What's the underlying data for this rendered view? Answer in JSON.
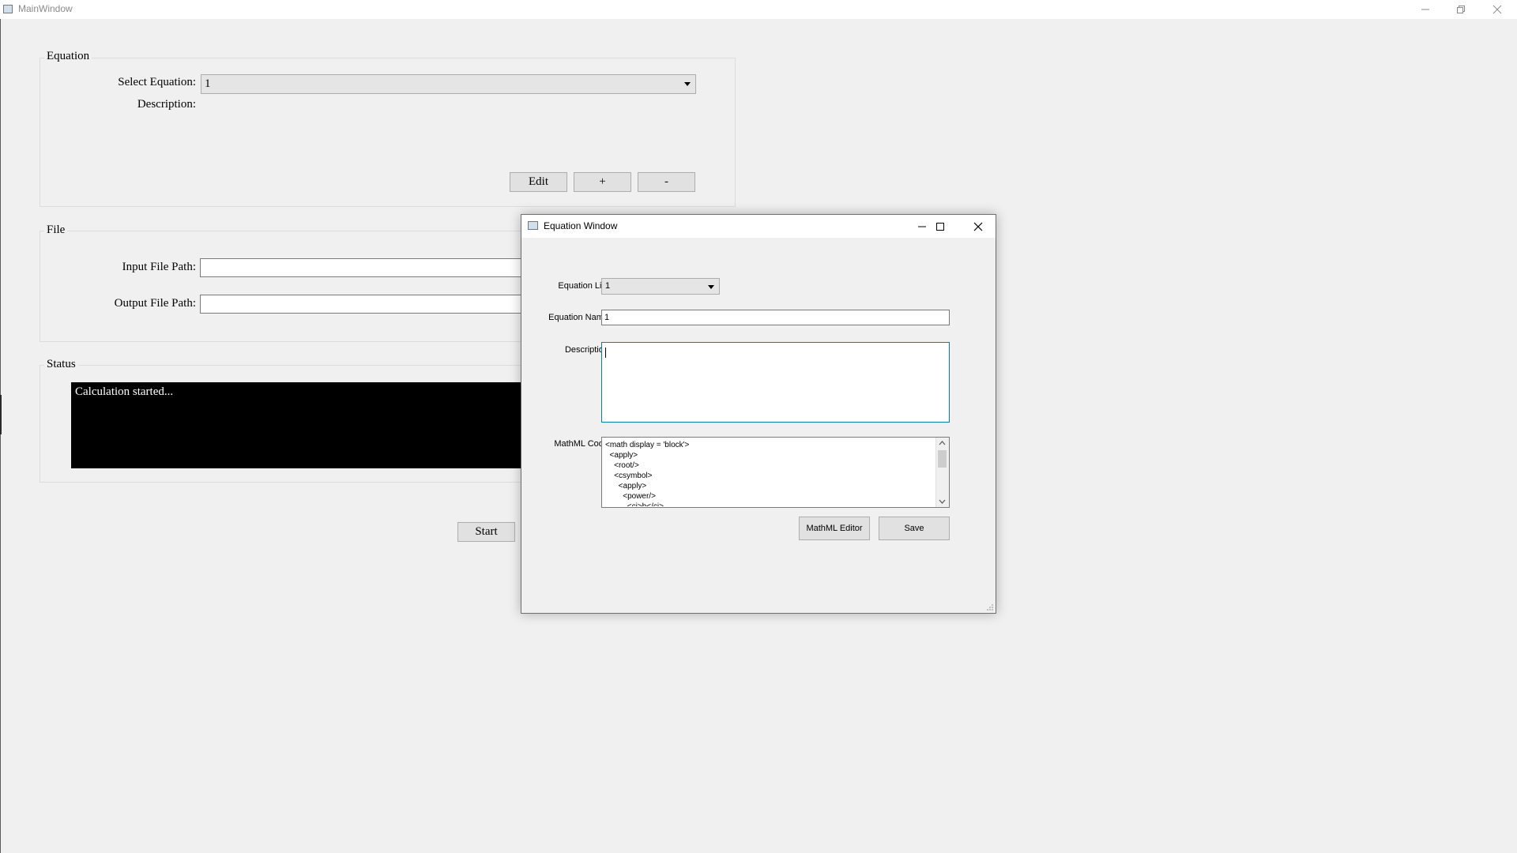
{
  "main_window": {
    "title": "MainWindow",
    "equation_group": {
      "title": "Equation",
      "select_label": "Select Equation:",
      "select_value": "1",
      "description_label": "Description:",
      "edit_label": "Edit",
      "add_label": "+",
      "remove_label": "-"
    },
    "file_group": {
      "title": "File",
      "input_label": "Input File Path:",
      "input_value": "",
      "output_label": "Output File Path:",
      "output_value": ""
    },
    "status_group": {
      "title": "Status",
      "console_text": "Calculation started..."
    },
    "start_label": "Start"
  },
  "equation_window": {
    "title": "Equation Window",
    "list_label": "Equation List",
    "list_value": "1",
    "name_label": "Equation Name",
    "name_value": "1",
    "description_label": "Description",
    "description_value": "",
    "mathml_label": "MathML Code",
    "mathml_lines": [
      "<math display = 'block'>",
      "  <apply>",
      "    <root/>",
      "    <csymbol>",
      "      <apply>",
      "        <power/>",
      "          <ci>b</ci>"
    ],
    "mathml_editor_label": "MathML Editor",
    "save_label": "Save"
  },
  "icons": [
    "window-icon",
    "minimize-icon",
    "restore-icon",
    "maximize-icon",
    "close-icon",
    "chevron-down-icon",
    "resize-grip-icon"
  ],
  "colors": {
    "console_bg": "#000000",
    "console_text": "#ffffff",
    "focus_border": "#0078d7"
  }
}
